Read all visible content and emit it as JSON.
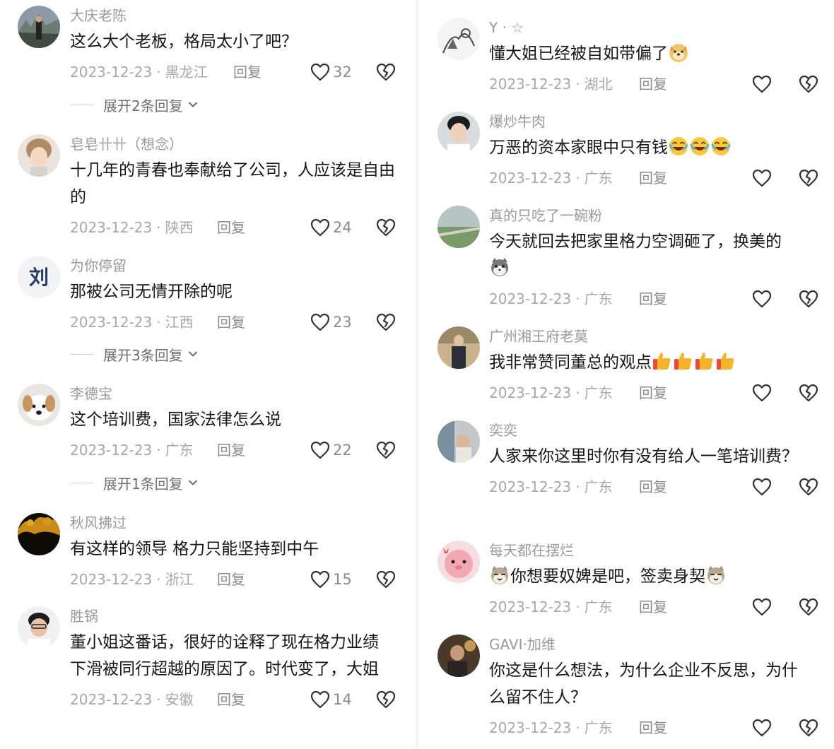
{
  "left": {
    "comments": [
      {
        "username": "大庆老陈",
        "text": "这么大个老板，格局太小了吧？",
        "date": "2023-12-23",
        "region": "黑龙江",
        "reply_label": "回复",
        "likes": "32"
      },
      {
        "username": "皂皂卄卄（想念）",
        "text": "十几年的青春也奉献给了公司，人应该是自由的",
        "date": "2023-12-23",
        "region": "陕西",
        "reply_label": "回复",
        "likes": "24"
      },
      {
        "username": "为你停留",
        "text": "那被公司无情开除的呢",
        "date": "2023-12-23",
        "region": "江西",
        "reply_label": "回复",
        "likes": "23"
      },
      {
        "username": "李德宝",
        "text": "这个培训费，国家法律怎么说",
        "date": "2023-12-23",
        "region": "广东",
        "reply_label": "回复",
        "likes": "22"
      },
      {
        "username": "秋风拂过",
        "text": "有这样的领导 格力只能坚持到中午",
        "date": "2023-12-23",
        "region": "浙江",
        "reply_label": "回复",
        "likes": "15"
      },
      {
        "username": "胜锅",
        "text": "董小姐这番话，很好的诠释了现在格力业绩下滑被同行超越的原因了。时代变了，大姐",
        "date": "2023-12-23",
        "region": "安徽",
        "reply_label": "回复",
        "likes": "14"
      }
    ],
    "expanders": [
      "展开2条回复",
      "展开3条回复",
      "展开1条回复"
    ]
  },
  "right": {
    "comments": [
      {
        "username": "Y · ☆",
        "text": "懂大姐已经被自如带偏了",
        "date": "2023-12-23",
        "region": "湖北",
        "reply_label": "回复"
      },
      {
        "username": "爆炒牛肉",
        "text": "万恶的资本家眼中只有钱",
        "date": "2023-12-23",
        "region": "广东",
        "reply_label": "回复"
      },
      {
        "username": "真的只吃了一碗粉",
        "text": "今天就回去把家里格力空调砸了，换美的",
        "date": "2023-12-23",
        "region": "广东",
        "reply_label": "回复"
      },
      {
        "username": "广州湘王府老莫",
        "text": "我非常赞同董总的观点",
        "date": "2023-12-23",
        "region": "广东",
        "reply_label": "回复"
      },
      {
        "username": "奕奕",
        "text": "人家来你这里时你有没有给人一笔培训费？",
        "date": "2023-12-23",
        "region": "广东",
        "reply_label": "回复"
      },
      {
        "username": "每天都在摆烂",
        "text_a": "你想要奴婢是吧，签卖身契",
        "date": "2023-12-23",
        "region": "广东",
        "reply_label": "回复"
      },
      {
        "username": "GAVI·加维",
        "text": "你这是什么想法，为什么企业不反思，为什么留不住人？",
        "date": "2023-12-23",
        "region": "广东",
        "reply_label": "回复"
      }
    ]
  },
  "icons": {
    "like": "heart-icon",
    "dislike": "broken-heart-icon",
    "expand": "chevron-down-icon"
  },
  "colors": {
    "meta": "#a7a7a7",
    "username": "#9a9a9a",
    "text": "#161616",
    "icon": "#333333"
  }
}
